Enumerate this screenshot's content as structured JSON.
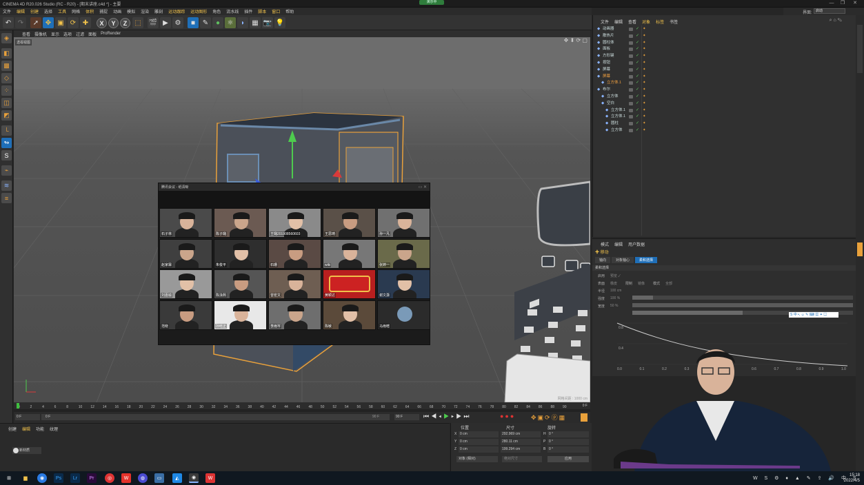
{
  "title_bar": {
    "title": "CINEMA 4D R20.026 Studio (RC - R20) - [期末讲座.c4d *] - 主要",
    "center_badge": "演示中",
    "window_controls": [
      "—",
      "❐",
      "✕"
    ]
  },
  "menu": {
    "items": [
      "文件",
      "编辑",
      "创建",
      "选择",
      "工具",
      "网格",
      "体积",
      "捕捉",
      "动画",
      "模拟",
      "渲染",
      "雕刻",
      "运动跟踪",
      "运动图形",
      "角色",
      "流水线",
      "插件",
      "脚本",
      "窗口",
      "帮助"
    ]
  },
  "layout_switch": {
    "label": "界面:",
    "value": "启动"
  },
  "toolbar": {
    "undo": "↶",
    "axes": [
      "X",
      "Y",
      "Z"
    ]
  },
  "viewport": {
    "menu": [
      "查看",
      "摄像机",
      "显示",
      "选项",
      "过滤",
      "面板",
      "ProRender"
    ],
    "camera_label": "透视视图",
    "grid_info": "网格间距 : 1000 cm"
  },
  "timeline": {
    "ticks": [
      "0",
      "2",
      "4",
      "6",
      "8",
      "10",
      "12",
      "14",
      "16",
      "18",
      "20",
      "22",
      "24",
      "26",
      "28",
      "30",
      "32",
      "34",
      "36",
      "38",
      "40",
      "42",
      "44",
      "46",
      "48",
      "50",
      "52",
      "54",
      "56",
      "58",
      "60",
      "62",
      "64",
      "66",
      "68",
      "70",
      "72",
      "74",
      "76",
      "78",
      "80",
      "82",
      "84",
      "86",
      "88",
      "90"
    ],
    "end_frame": "0 F",
    "current_frame": "0 F",
    "start_field": "0 F",
    "max_field": "90 F",
    "max_field2": "90 F"
  },
  "material_panel": {
    "tabs": [
      "创建",
      "编辑",
      "功能",
      "纹理"
    ],
    "item": "新材质"
  },
  "coordinates": {
    "headers": [
      "位置",
      "尺寸",
      "旋转"
    ],
    "rows": [
      {
        "axis": "X",
        "pos": "0 cm",
        "size": "292.969 cm",
        "rot_axis": "H",
        "rot": "0 °"
      },
      {
        "axis": "Y",
        "pos": "0 cm",
        "size": "280.11 cm",
        "rot_axis": "P",
        "rot": "0 °"
      },
      {
        "axis": "Z",
        "pos": "0 cm",
        "size": "199.294 cm",
        "rot_axis": "B",
        "rot": "0 °"
      }
    ],
    "mode": "对象 (相对)",
    "size_mode": "绝对尺寸",
    "apply": "应用"
  },
  "object_manager": {
    "menu": [
      "文件",
      "编辑",
      "查看",
      "对象",
      "标签",
      "书签"
    ],
    "objects": [
      {
        "name": "动画器",
        "indent": 0
      },
      {
        "name": "散热片",
        "indent": 0
      },
      {
        "name": "圆柱体",
        "indent": 0
      },
      {
        "name": "面板",
        "indent": 0
      },
      {
        "name": "方形键",
        "indent": 0
      },
      {
        "name": "按钮",
        "indent": 0
      },
      {
        "name": "屏幕",
        "indent": 0
      },
      {
        "name": "屏幕",
        "indent": 0,
        "highlight": true
      },
      {
        "name": "立方体.1",
        "indent": 1,
        "highlight": true
      },
      {
        "name": "布尔",
        "indent": 0
      },
      {
        "name": "立方体",
        "indent": 1
      },
      {
        "name": "空白",
        "indent": 1
      },
      {
        "name": "立方体.1",
        "indent": 2
      },
      {
        "name": "立方体.1",
        "indent": 2
      },
      {
        "name": "圆柱",
        "indent": 2
      },
      {
        "name": "立方体",
        "indent": 2
      }
    ]
  },
  "attributes": {
    "menu": [
      "模式",
      "编辑",
      "用户数据"
    ],
    "object": "移动",
    "tabs": [
      "轴向",
      "对象轴心",
      "柔和选择"
    ],
    "section": "柔和选择",
    "fields": [
      {
        "label": "启用",
        "value": "预览 ✓"
      },
      {
        "label": "表面",
        "value": "橡皮"
      },
      {
        "label": "限制",
        "value": "镜像"
      },
      {
        "label": "模式",
        "value": "全部"
      },
      {
        "label": "半径",
        "value": "100 cm"
      },
      {
        "label": "强度",
        "value": "100 %"
      },
      {
        "label": "宽度",
        "value": "50 %"
      }
    ],
    "curve_x_ticks": [
      "0.0",
      "0.1",
      "0.2",
      "0.3",
      "0.4",
      "0.5",
      "0.6",
      "0.7",
      "0.8",
      "0.9",
      "1.0"
    ],
    "curve_y_ticks": [
      "0.8",
      "0.4"
    ]
  },
  "meeting": {
    "title": "腾讯会议 - 纸清晰",
    "participants": [
      "石子林",
      "陈子璐",
      "王璐201908560603",
      "王思琦",
      "孙一凡",
      "赵家霖",
      "朱俊平",
      "石珊",
      "wiki",
      "张婷一",
      "刘嘉瑜",
      "陈泳熙",
      "曾宏文",
      "黄颖达",
      "谢文灏",
      "范晓",
      "孙晗正",
      "李雨岑",
      "陈敏",
      "马雨暄"
    ]
  },
  "taskbar": {
    "time": "15:18",
    "date": "2022/4/5"
  },
  "colors": {
    "accent_blue": "#1f6fb8",
    "selection_orange": "#e9a13b",
    "viewport_gray": "#5b5b5b"
  }
}
